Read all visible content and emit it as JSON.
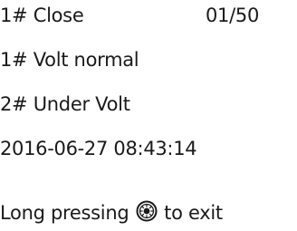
{
  "record": {
    "title": "1# Close",
    "index": "01/50",
    "line1": "1# Volt normal",
    "line2": "2# Under Volt",
    "timestamp": "2016-06-27 08:43:14"
  },
  "footer": {
    "hint_before": "Long pressing",
    "hint_icon": "knob-icon",
    "hint_after": "to exit"
  }
}
